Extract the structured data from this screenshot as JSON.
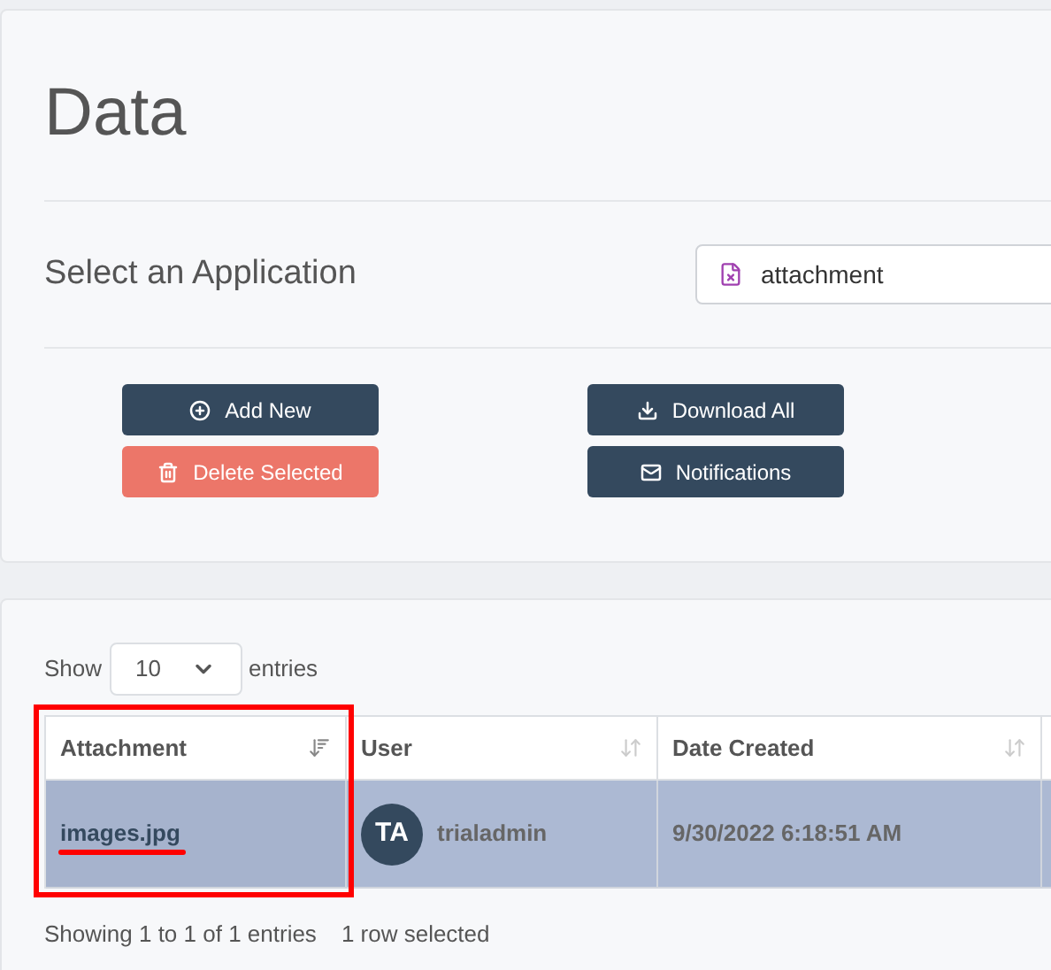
{
  "page_title": "Data",
  "application": {
    "label": "Select an Application",
    "value": "attachment"
  },
  "actions": [
    {
      "label": "Add New",
      "kind": "add"
    },
    {
      "label": "Download All",
      "kind": "download"
    },
    {
      "label": "Delete Selected",
      "kind": "delete"
    },
    {
      "label": "Notifications",
      "kind": "notify"
    }
  ],
  "length": {
    "before": "Show",
    "value": "10",
    "after": "entries"
  },
  "table": {
    "columns": [
      {
        "label": "Attachment",
        "sorted": true,
        "highlighted": true
      },
      {
        "label": "User",
        "sorted": false,
        "highlighted": false
      },
      {
        "label": "Date Created",
        "sorted": false,
        "highlighted": false
      },
      {
        "highlighted": false
      }
    ],
    "rows": [
      {
        "selected": true,
        "attachment": "images.jpg",
        "avatar": "TA",
        "user": "trialadmin",
        "date": "9/30/2022 6:18:51 AM"
      }
    ]
  },
  "info": "Showing 1 to 1 of 1 entries",
  "selection_info": "1 row selected"
}
